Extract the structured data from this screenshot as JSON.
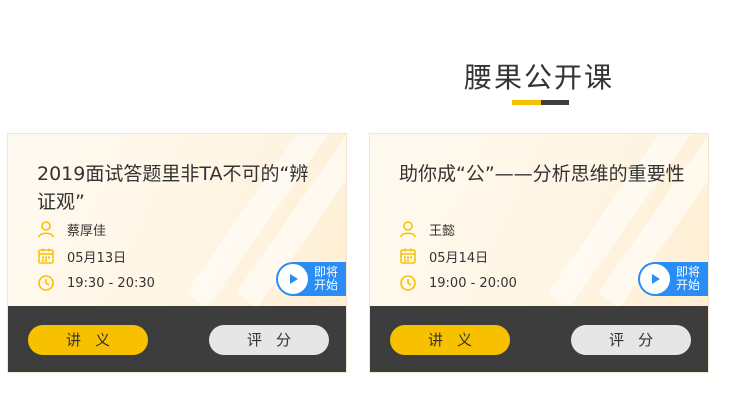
{
  "section": {
    "title": "腰果公开课"
  },
  "colors": {
    "accent": "#f7c100",
    "dark": "#3e3e3e",
    "live_blue": "#2a8cf5"
  },
  "cards": [
    {
      "title": "2019面试答题里非TA不可的“辨证观”",
      "teacher": "蔡厚佳",
      "date": "05月13日",
      "time": "19:30 - 20:30",
      "badge": "即将开始",
      "handout_label": "讲义",
      "rate_label": "评分",
      "icons": {
        "teacher": "user-icon",
        "date": "calendar-icon",
        "time": "clock-icon",
        "badge": "play-icon"
      }
    },
    {
      "title": "助你成“公”——分析思维的重要性",
      "teacher": "王懿",
      "date": "05月14日",
      "time": "19:00 - 20:00",
      "badge": "即将开始",
      "handout_label": "讲义",
      "rate_label": "评分",
      "icons": {
        "teacher": "user-icon",
        "date": "calendar-icon",
        "time": "clock-icon",
        "badge": "play-icon"
      }
    }
  ]
}
